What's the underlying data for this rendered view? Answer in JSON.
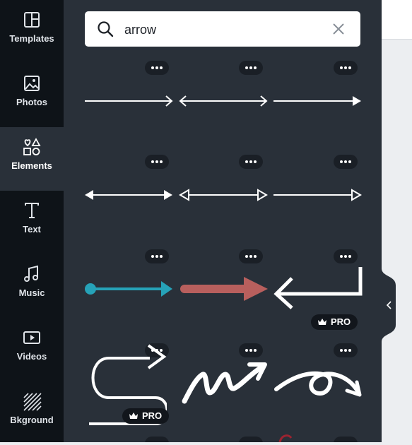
{
  "sidebar": {
    "items": [
      {
        "label": "Templates",
        "icon": "templates-icon"
      },
      {
        "label": "Photos",
        "icon": "photos-icon"
      },
      {
        "label": "Elements",
        "icon": "elements-icon",
        "active": true
      },
      {
        "label": "Text",
        "icon": "text-icon"
      },
      {
        "label": "Music",
        "icon": "music-icon"
      },
      {
        "label": "Videos",
        "icon": "videos-icon"
      },
      {
        "label": "Bkground",
        "icon": "background-icon"
      }
    ]
  },
  "search": {
    "value": "arrow",
    "icon": "search-icon",
    "clear_icon": "close-icon"
  },
  "results": {
    "pro_label": "PRO",
    "items": [
      {
        "name": "thin-arrow-right"
      },
      {
        "name": "thin-arrow-double"
      },
      {
        "name": "solid-arrow-right"
      },
      {
        "name": "double-arrow-bold-heads"
      },
      {
        "name": "double-arrow-outline-heads"
      },
      {
        "name": "arrow-outline-head"
      },
      {
        "name": "teal-dot-arrow"
      },
      {
        "name": "red-thick-arrow"
      },
      {
        "name": "return-arrow",
        "pro": true
      },
      {
        "name": "s-curve-arrow",
        "pro": true
      },
      {
        "name": "zigzag-scribble-arrow"
      },
      {
        "name": "loop-scribble-arrow"
      }
    ]
  },
  "colors": {
    "panel": "#293039",
    "rail": "#0e1318",
    "teal": "#26a2b8",
    "red": "#b85f5d"
  }
}
